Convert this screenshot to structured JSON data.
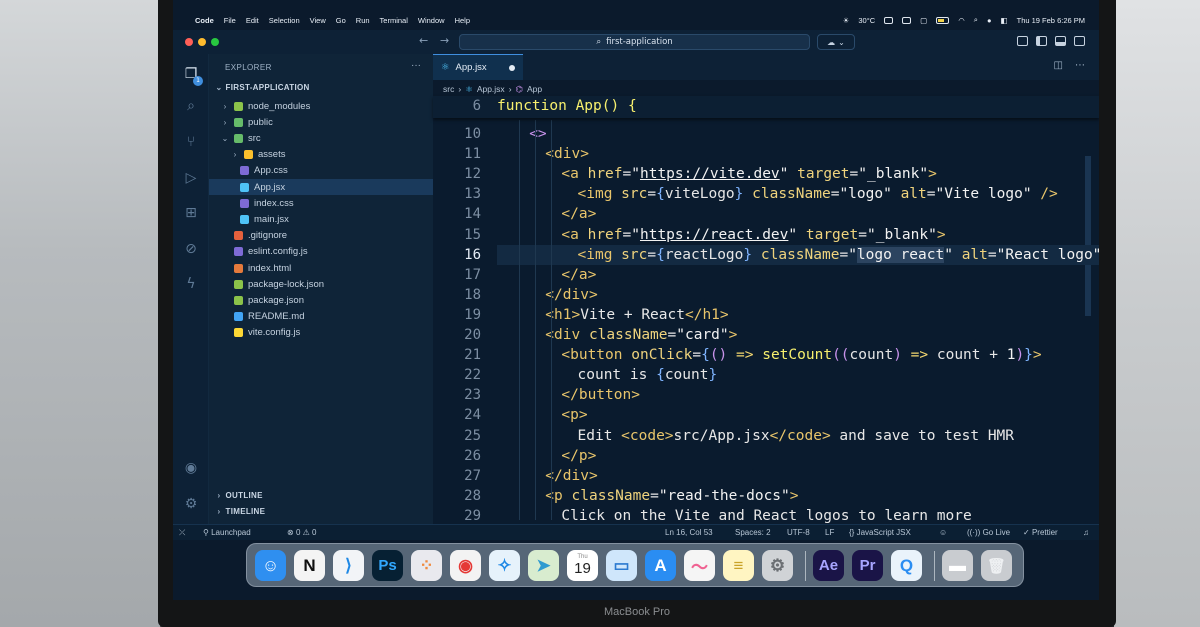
{
  "menubar": {
    "items": [
      "Code",
      "File",
      "Edit",
      "Selection",
      "View",
      "Go",
      "Run",
      "Terminal",
      "Window",
      "Help"
    ],
    "weather": "30°C",
    "datetime": "Thu 19 Feb  6:26 PM"
  },
  "titlebar": {
    "search_text": "first-application"
  },
  "sidebar": {
    "title": "EXPLORER",
    "more": "···",
    "project": "FIRST-APPLICATION",
    "tree": [
      {
        "label": "node_modules",
        "type": "folder",
        "depth": 1,
        "icon_color": "#8bc34a"
      },
      {
        "label": "public",
        "type": "folder",
        "depth": 1,
        "icon_color": "#66bb6a"
      },
      {
        "label": "src",
        "type": "folder-open",
        "depth": 1,
        "icon_color": "#66bb6a"
      },
      {
        "label": "assets",
        "type": "folder",
        "depth": 2,
        "icon_color": "#fbc02d"
      },
      {
        "label": "App.css",
        "type": "file",
        "depth": 2,
        "icon_color": "#7e6bd6"
      },
      {
        "label": "App.jsx",
        "type": "file",
        "depth": 2,
        "icon_color": "#4fc3f7",
        "selected": true
      },
      {
        "label": "index.css",
        "type": "file",
        "depth": 2,
        "icon_color": "#7e6bd6"
      },
      {
        "label": "main.jsx",
        "type": "file",
        "depth": 2,
        "icon_color": "#4fc3f7"
      },
      {
        "label": ".gitignore",
        "type": "file",
        "depth": 1,
        "icon_color": "#e5613d"
      },
      {
        "label": "eslint.config.js",
        "type": "file",
        "depth": 1,
        "icon_color": "#7e6bd6"
      },
      {
        "label": "index.html",
        "type": "file",
        "depth": 1,
        "icon_color": "#e57a3c"
      },
      {
        "label": "package-lock.json",
        "type": "file",
        "depth": 1,
        "icon_color": "#8bc34a"
      },
      {
        "label": "package.json",
        "type": "file",
        "depth": 1,
        "icon_color": "#8bc34a"
      },
      {
        "label": "README.md",
        "type": "file",
        "depth": 1,
        "icon_color": "#42a5f5"
      },
      {
        "label": "vite.config.js",
        "type": "file",
        "depth": 1,
        "icon_color": "#fdd835"
      }
    ],
    "outline": "OUTLINE",
    "timeline": "TIMELINE"
  },
  "editor": {
    "tab_label": "App.jsx",
    "breadcrumb": [
      "src",
      "App.jsx",
      "App"
    ],
    "sticky_line_number": "6",
    "sticky_line": "function App() {",
    "current_line": "16",
    "lines": [
      {
        "n": "10",
        "indent": 2,
        "html": "<span class='p'>&lt;&gt;</span>"
      },
      {
        "n": "11",
        "indent": 3,
        "html": "<span class='t'>&lt;div&gt;</span>"
      },
      {
        "n": "12",
        "indent": 4,
        "html": "<span class='t'>&lt;a</span> <span class='a'>href</span>=<span class='s'>\"</span><span class='u'>https://vite.dev</span><span class='s'>\"</span> <span class='a'>target</span>=<span class='s'>\"_blank\"</span><span class='t'>&gt;</span>"
      },
      {
        "n": "13",
        "indent": 5,
        "html": "<span class='t'>&lt;img</span> <span class='a'>src</span>=<span class='b'>{</span>viteLogo<span class='b'>}</span> <span class='a'>className</span>=<span class='s'>\"logo\"</span> <span class='a'>alt</span>=<span class='s'>\"Vite logo\"</span> <span class='t'>/&gt;</span>"
      },
      {
        "n": "14",
        "indent": 4,
        "html": "<span class='t'>&lt;/a&gt;</span>"
      },
      {
        "n": "15",
        "indent": 4,
        "html": "<span class='t'>&lt;a</span> <span class='a'>href</span>=<span class='s'>\"</span><span class='u'>https://react.dev</span><span class='s'>\"</span> <span class='a'>target</span>=<span class='s'>\"_blank\"</span><span class='t'>&gt;</span>"
      },
      {
        "n": "16",
        "indent": 5,
        "html": "<span class='t'>&lt;img</span> <span class='a'>src</span>=<span class='b'>{</span>reactLogo<span class='b'>}</span> <span class='a'>className</span>=<span class='s'>\"<span class='hl'>logo react</span>\"</span> <span class='a'>alt</span>=<span class='s'>\"React logo\"</span> <span class='t'>/&gt;</span>"
      },
      {
        "n": "17",
        "indent": 4,
        "html": "<span class='t'>&lt;/a&gt;</span>"
      },
      {
        "n": "18",
        "indent": 3,
        "html": "<span class='t'>&lt;/div&gt;</span>"
      },
      {
        "n": "19",
        "indent": 3,
        "html": "<span class='t'>&lt;h1&gt;</span><span class='txt'>Vite + React</span><span class='t'>&lt;/h1&gt;</span>"
      },
      {
        "n": "20",
        "indent": 3,
        "html": "<span class='t'>&lt;div</span> <span class='a'>className</span>=<span class='s'>\"card\"</span><span class='t'>&gt;</span>"
      },
      {
        "n": "21",
        "indent": 4,
        "html": "<span class='t'>&lt;button</span> <span class='a'>onClick</span>=<span class='b'>{</span><span class='p'>()</span> <span class='k'>=&gt;</span> <span class='f'>setCount</span><span class='p'>((</span>count<span class='p'>)</span> <span class='k'>=&gt;</span> count + <span class='s'>1</span><span class='p'>)</span><span class='b'>}</span><span class='t'>&gt;</span>"
      },
      {
        "n": "22",
        "indent": 5,
        "html": "<span class='txt'>count is </span><span class='b'>{</span>count<span class='b'>}</span>"
      },
      {
        "n": "23",
        "indent": 4,
        "html": "<span class='t'>&lt;/button&gt;</span>"
      },
      {
        "n": "24",
        "indent": 4,
        "html": "<span class='t'>&lt;p&gt;</span>"
      },
      {
        "n": "25",
        "indent": 5,
        "html": "<span class='txt'>Edit </span><span class='t'>&lt;code&gt;</span><span class='txt'>src/App.jsx</span><span class='t'>&lt;/code&gt;</span><span class='txt'> and save to test HMR</span>"
      },
      {
        "n": "26",
        "indent": 4,
        "html": "<span class='t'>&lt;/p&gt;</span>"
      },
      {
        "n": "27",
        "indent": 3,
        "html": "<span class='t'>&lt;/div&gt;</span>"
      },
      {
        "n": "28",
        "indent": 3,
        "html": "<span class='t'>&lt;p</span> <span class='a'>className</span>=<span class='s'>\"read-the-docs\"</span><span class='t'>&gt;</span>"
      },
      {
        "n": "29",
        "indent": 4,
        "html": "<span class='txt'>Click on the Vite and React logos to learn more</span>"
      }
    ]
  },
  "statusbar": {
    "launchpad": "Launchpad",
    "problems": "0",
    "warnings": "0",
    "position": "Ln 16, Col 53",
    "spaces": "Spaces: 2",
    "encoding": "UTF-8",
    "eol": "LF",
    "language": "JavaScript JSX",
    "golive": "Go Live",
    "prettier": "Prettier"
  },
  "dock": {
    "apps": [
      {
        "name": "finder-icon",
        "bg": "#2f8ff0",
        "fg": "#ffffff",
        "glyph": "☺"
      },
      {
        "name": "notion-icon",
        "bg": "#f4f4f4",
        "fg": "#111111",
        "glyph": "N"
      },
      {
        "name": "vscode-icon",
        "bg": "#f2f4f7",
        "fg": "#1e88e5",
        "glyph": "⟩"
      },
      {
        "name": "photoshop-icon",
        "bg": "#062033",
        "fg": "#31a8ff",
        "glyph": "Ps"
      },
      {
        "name": "launchpad-icon",
        "bg": "#e9e9ee",
        "fg": "#f08a3e",
        "glyph": "⁘"
      },
      {
        "name": "chrome-icon",
        "bg": "#f3f3f3",
        "fg": "#e53935",
        "glyph": "◉"
      },
      {
        "name": "safari-icon",
        "bg": "#e6f2fb",
        "fg": "#1e88e5",
        "glyph": "✧"
      },
      {
        "name": "maps-icon",
        "bg": "#d8eccf",
        "fg": "#2e9ad0",
        "glyph": "➤"
      },
      {
        "name": "calendar-icon",
        "bg": "#ffffff",
        "fg": "#222222",
        "glyph": "19",
        "caption": "Thu"
      },
      {
        "name": "finder-window-icon",
        "bg": "#cfe6fb",
        "fg": "#2c7ad0",
        "glyph": "▭"
      },
      {
        "name": "app-store-icon",
        "bg": "#2a8df2",
        "fg": "#ffffff",
        "glyph": "A"
      },
      {
        "name": "freeform-icon",
        "bg": "#f5f5f5",
        "fg": "#f06292",
        "glyph": "〜"
      },
      {
        "name": "notes-icon",
        "bg": "#fff5c2",
        "fg": "#c9a227",
        "glyph": "≡"
      },
      {
        "name": "settings-icon",
        "bg": "#d0d3d6",
        "fg": "#6b6f73",
        "glyph": "⚙"
      },
      {
        "name": "after-effects-icon",
        "bg": "#1a1447",
        "fg": "#a8a5ff",
        "glyph": "Ae"
      },
      {
        "name": "premiere-icon",
        "bg": "#1a1447",
        "fg": "#a8a5ff",
        "glyph": "Pr"
      },
      {
        "name": "quicktime-icon",
        "bg": "#eaf3fb",
        "fg": "#2a8df2",
        "glyph": "Q"
      },
      {
        "name": "downloads-icon",
        "bg": "#c9ccd0",
        "fg": "#ffffff",
        "glyph": "▬"
      },
      {
        "name": "trash-icon",
        "bg": "#c9ccd0",
        "fg": "#eef0f2",
        "glyph": "🗑"
      }
    ]
  },
  "device": {
    "label": "MacBook Pro"
  }
}
